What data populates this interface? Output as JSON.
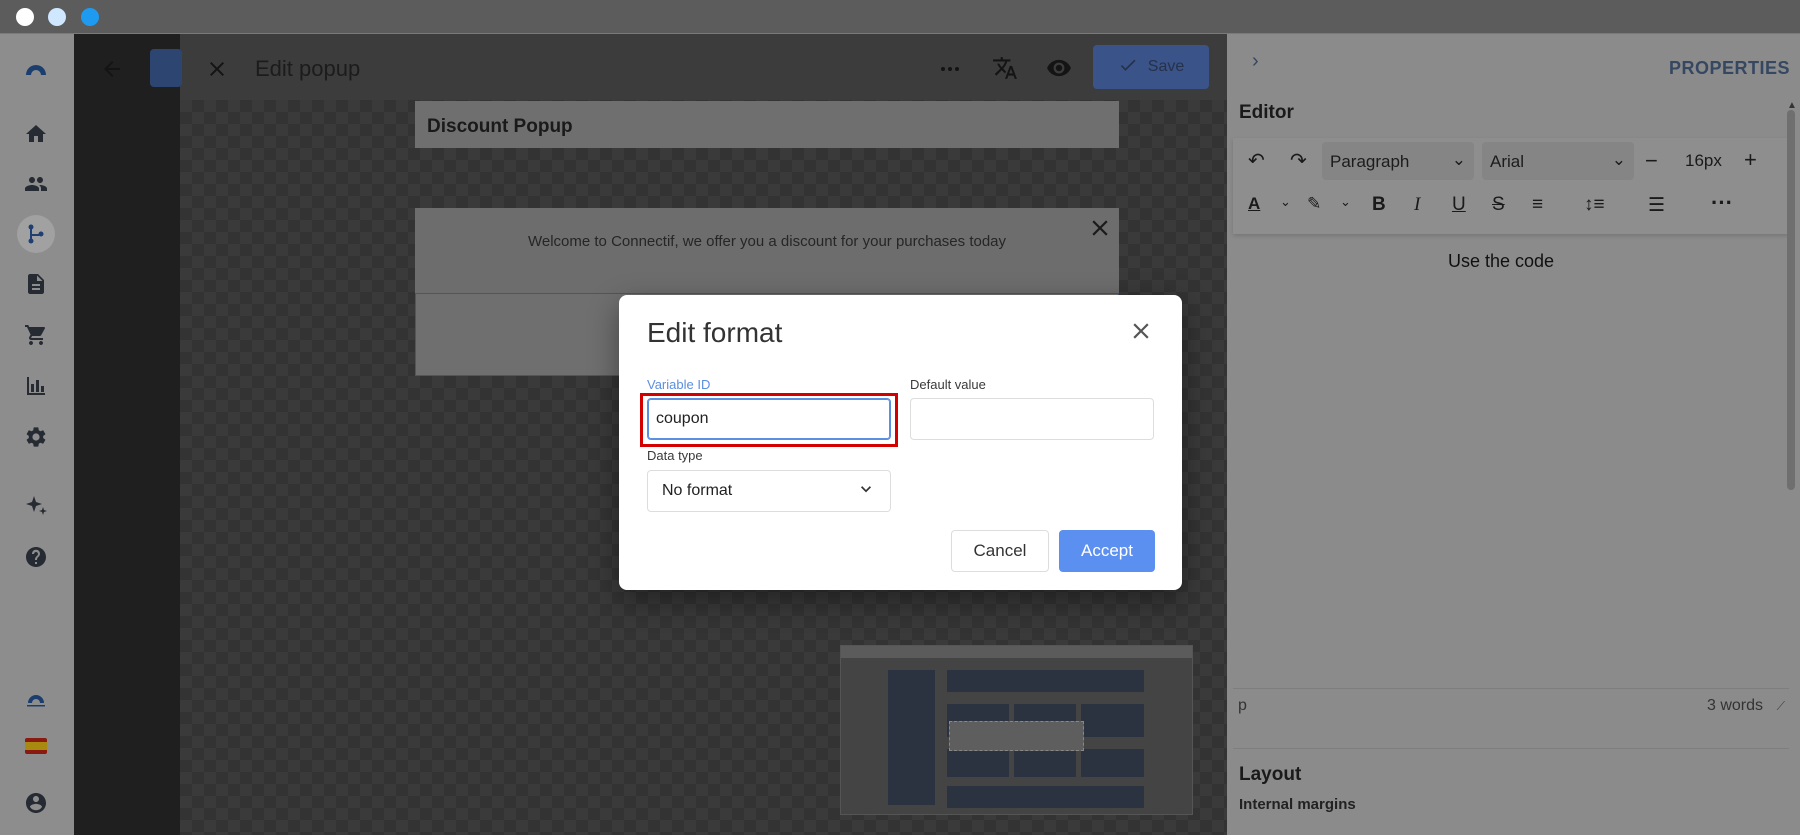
{
  "window": {
    "traffic_colors": [
      "#ffffff",
      "#cfe8ff",
      "#1e9bf0"
    ]
  },
  "nav": {
    "items": [
      "logo-icon",
      "home-icon",
      "users-icon",
      "workflow-icon",
      "document-icon",
      "cart-icon",
      "chart-icon",
      "gear-icon",
      "sparkle-icon",
      "help-icon",
      "brand-icon",
      "flag-es-icon",
      "account-icon"
    ]
  },
  "editor": {
    "title": "Edit popup",
    "save_label": "Save",
    "popup_title": "Discount Popup",
    "popup_message": "Welcome to Connectif, we offer you a discount for your purchases today"
  },
  "properties": {
    "header": "PROPERTIES",
    "editor_heading": "Editor",
    "block_format": "Paragraph",
    "font_family": "Arial",
    "font_size": "16px",
    "content_text": "Use the code",
    "status_tag": "p",
    "word_count": "3 words",
    "layout_heading": "Layout",
    "internal_margins": "Internal margins"
  },
  "modal": {
    "title": "Edit format",
    "variable_id_label": "Variable ID",
    "variable_id_value": "coupon",
    "default_value_label": "Default value",
    "default_value_value": "",
    "data_type_label": "Data type",
    "data_type_value": "No format",
    "cancel_label": "Cancel",
    "accept_label": "Accept"
  },
  "colors": {
    "accent": "#5b8ff0",
    "highlight": "#d40000"
  }
}
